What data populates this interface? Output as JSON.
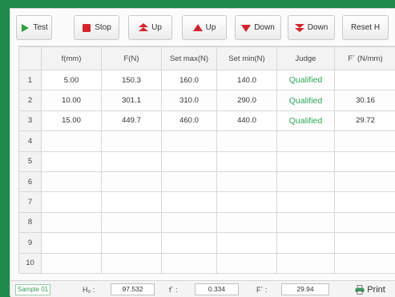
{
  "toolbar": {
    "buttons": [
      {
        "label": "Test",
        "icon": "play-icon",
        "color": "#2e9d3e"
      },
      {
        "label": "Stop",
        "icon": "stop-icon",
        "color": "#d4232b"
      },
      {
        "label": "Up",
        "icon": "double-up-icon",
        "color": "#d4232b"
      },
      {
        "label": "Up",
        "icon": "up-icon",
        "color": "#d4232b"
      },
      {
        "label": "Down",
        "icon": "down-icon",
        "color": "#d4232b"
      },
      {
        "label": "Down",
        "icon": "double-down-icon",
        "color": "#d4232b"
      },
      {
        "label": "Reset H",
        "icon": null,
        "color": null
      }
    ]
  },
  "table": {
    "headers": [
      "",
      "f(mm)",
      "F(N)",
      "Set max(N)",
      "Set min(N)",
      "Judge",
      "F´ (N/mm)"
    ],
    "rows": [
      [
        "1",
        "5.00",
        "150.3",
        "160.0",
        "140.0",
        "Qualified",
        ""
      ],
      [
        "2",
        "10.00",
        "301.1",
        "310.0",
        "290.0",
        "Qualified",
        "30.16"
      ],
      [
        "3",
        "15.00",
        "449.7",
        "460.0",
        "440.0",
        "Qualified",
        "29.72"
      ],
      [
        "4",
        "",
        "",
        "",
        "",
        "",
        ""
      ],
      [
        "5",
        "",
        "",
        "",
        "",
        "",
        ""
      ],
      [
        "6",
        "",
        "",
        "",
        "",
        "",
        ""
      ],
      [
        "7",
        "",
        "",
        "",
        "",
        "",
        ""
      ],
      [
        "8",
        "",
        "",
        "",
        "",
        "",
        ""
      ],
      [
        "9",
        "",
        "",
        "",
        "",
        "",
        ""
      ],
      [
        "10",
        "",
        "",
        "",
        "",
        "",
        ""
      ]
    ]
  },
  "status": {
    "sample": "Sample 01",
    "h0_label": "H₀ :",
    "h0_value": "97.532",
    "f_label": "f´ :",
    "f_value": "0.334",
    "F_label": "F´ :",
    "F_value": "29.94",
    "print_label": "Print"
  },
  "colors": {
    "background": "#1f8a4c",
    "qualified": "#2ea55a",
    "accent_red": "#d4232b"
  }
}
